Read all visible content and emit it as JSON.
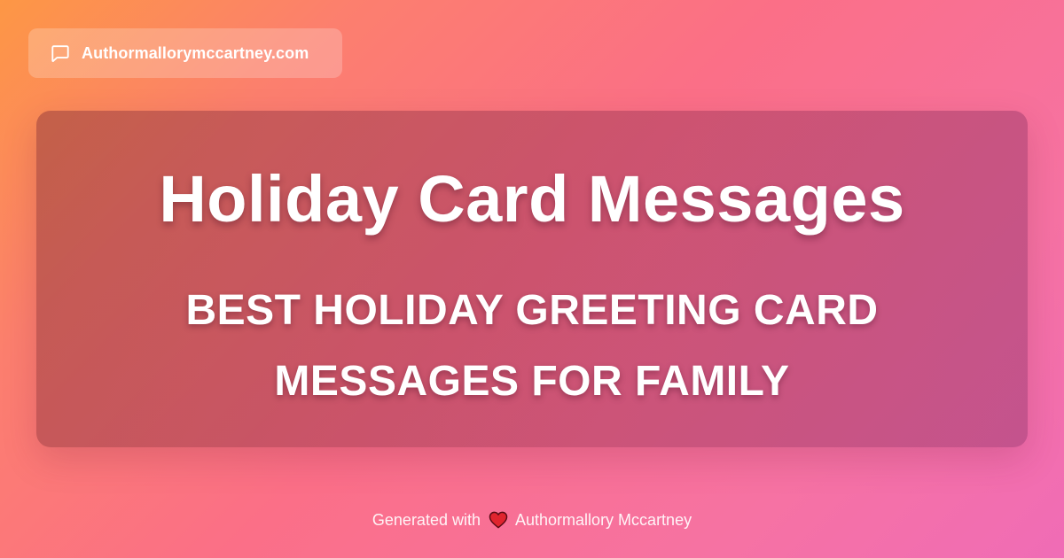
{
  "header": {
    "site_name": "Authormallorymccartney.com",
    "site_icon": "message-bubble-icon"
  },
  "card": {
    "title": "Holiday Card Messages",
    "subtitle": "BEST HOLIDAY GREETING CARD MESSAGES FOR FAMILY"
  },
  "footer": {
    "prefix": "Generated with",
    "heart_icon": "heart-icon",
    "author": "Authormallory Mccartney"
  },
  "colors": {
    "gradient_start": "#fd9745",
    "gradient_mid": "#fb6f87",
    "gradient_end": "#f06cb6",
    "text": "#ffffff",
    "heart": "#e0242e"
  }
}
